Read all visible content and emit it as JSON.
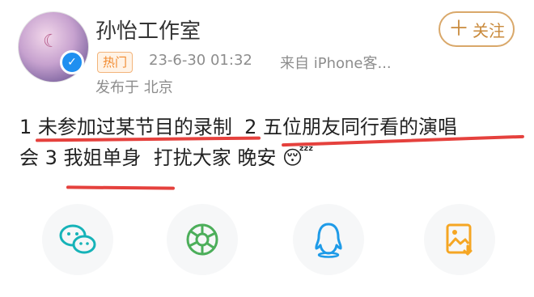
{
  "user": {
    "name": "孙怡工作室",
    "avatar_icon": "moon-avatar",
    "verified_icon": "verified-check-icon"
  },
  "meta": {
    "hot_badge": "热门",
    "time": "23-6-30 01:32",
    "source": "来自 iPhone客...",
    "location": "发布于 北京"
  },
  "follow": {
    "label": "关注",
    "icon": "plus-icon"
  },
  "post": {
    "line1": "1 未参加过某节目的录制  2 五位朋友同行看的演唱",
    "line2": "会 3 我姐单身  打扰大家 晚安 😴"
  },
  "share": [
    {
      "name": "wechat",
      "icon": "wechat-icon",
      "color": "#16b3b8"
    },
    {
      "name": "moments",
      "icon": "moments-icon",
      "color": "#4cae5a"
    },
    {
      "name": "qq",
      "icon": "qq-icon",
      "color": "#1e9be8"
    },
    {
      "name": "save-image",
      "icon": "save-image-icon",
      "color": "#f5a623"
    }
  ],
  "colors": {
    "underline": "#e5413d",
    "follow": "#c98a3c",
    "hot": "#f28a2e",
    "verified": "#1f8ff0"
  }
}
